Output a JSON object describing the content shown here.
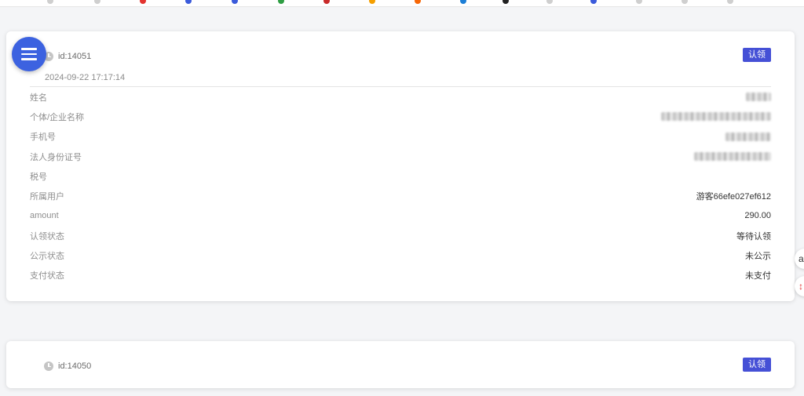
{
  "cards": [
    {
      "id_text": "id:14051",
      "datetime": "2024-09-22 17:17:14",
      "claim_label": "认领",
      "rows": [
        {
          "label": "姓名",
          "value": ""
        },
        {
          "label": "个体/企业名称",
          "value": ""
        },
        {
          "label": "手机号",
          "value": ""
        },
        {
          "label": "法人身份证号",
          "value": ""
        },
        {
          "label": "税号",
          "value": ""
        },
        {
          "label": "所属用户",
          "value": "游客66efe027ef612"
        },
        {
          "label": "amount",
          "value": "290.00"
        },
        {
          "label": "认领状态",
          "value": "等待认领"
        },
        {
          "label": "公示状态",
          "value": "未公示"
        },
        {
          "label": "支付状态",
          "value": "未支付"
        }
      ]
    },
    {
      "id_text": "id:14050",
      "claim_label": "认领"
    }
  ],
  "floating": {
    "menu_icon": "hamburger-menu-icon",
    "side_buttons": [
      "partial-icon",
      "partial-red-icon"
    ]
  },
  "colors": {
    "accent": "#4550d6",
    "menu_fab": "#3c62e0"
  }
}
